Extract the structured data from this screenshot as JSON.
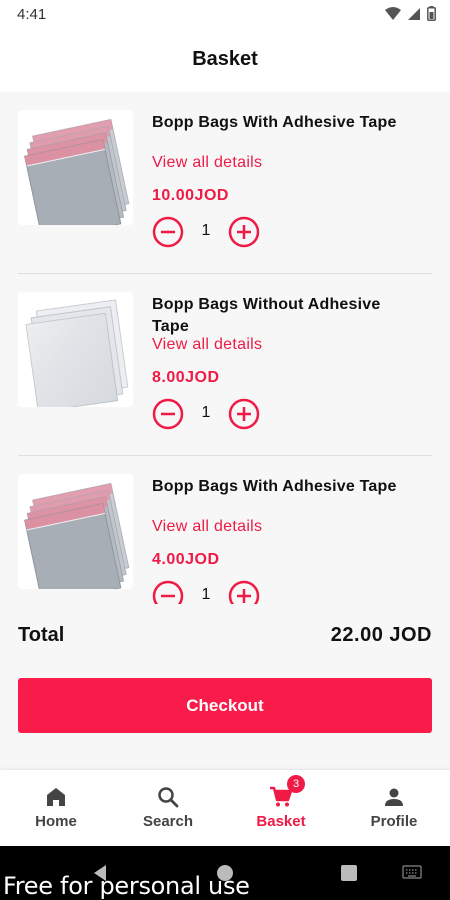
{
  "status_bar": {
    "time": "4:41"
  },
  "header": {
    "title": "Basket"
  },
  "items": [
    {
      "name": "Bopp Bags With Adhesive Tape",
      "details_link": "View all details",
      "price": "10.00JOD",
      "quantity": "1",
      "image": "bopp-bags-adhesive-image"
    },
    {
      "name": "Bopp Bags Without Adhesive Tape",
      "details_link": "View all details",
      "price": "8.00JOD",
      "quantity": "1",
      "image": "bopp-bags-plain-image"
    },
    {
      "name": "Bopp Bags With Adhesive Tape",
      "details_link": "View all details",
      "price": "4.00JOD",
      "quantity": "1",
      "image": "bopp-bags-adhesive-image"
    }
  ],
  "summary": {
    "total_label": "Total",
    "total_value": "22.00 JOD"
  },
  "checkout": {
    "label": "Checkout"
  },
  "bottom_nav": {
    "items": [
      {
        "label": "Home",
        "icon": "home-icon"
      },
      {
        "label": "Search",
        "icon": "search-icon"
      },
      {
        "label": "Basket",
        "icon": "cart-icon",
        "badge": "3",
        "active": true
      },
      {
        "label": "Profile",
        "icon": "person-icon"
      }
    ]
  },
  "watermark": "Free for personal use",
  "colors": {
    "accent": "#ef1a45",
    "checkout": "#f91c4a",
    "background": "#f7f7f7"
  }
}
